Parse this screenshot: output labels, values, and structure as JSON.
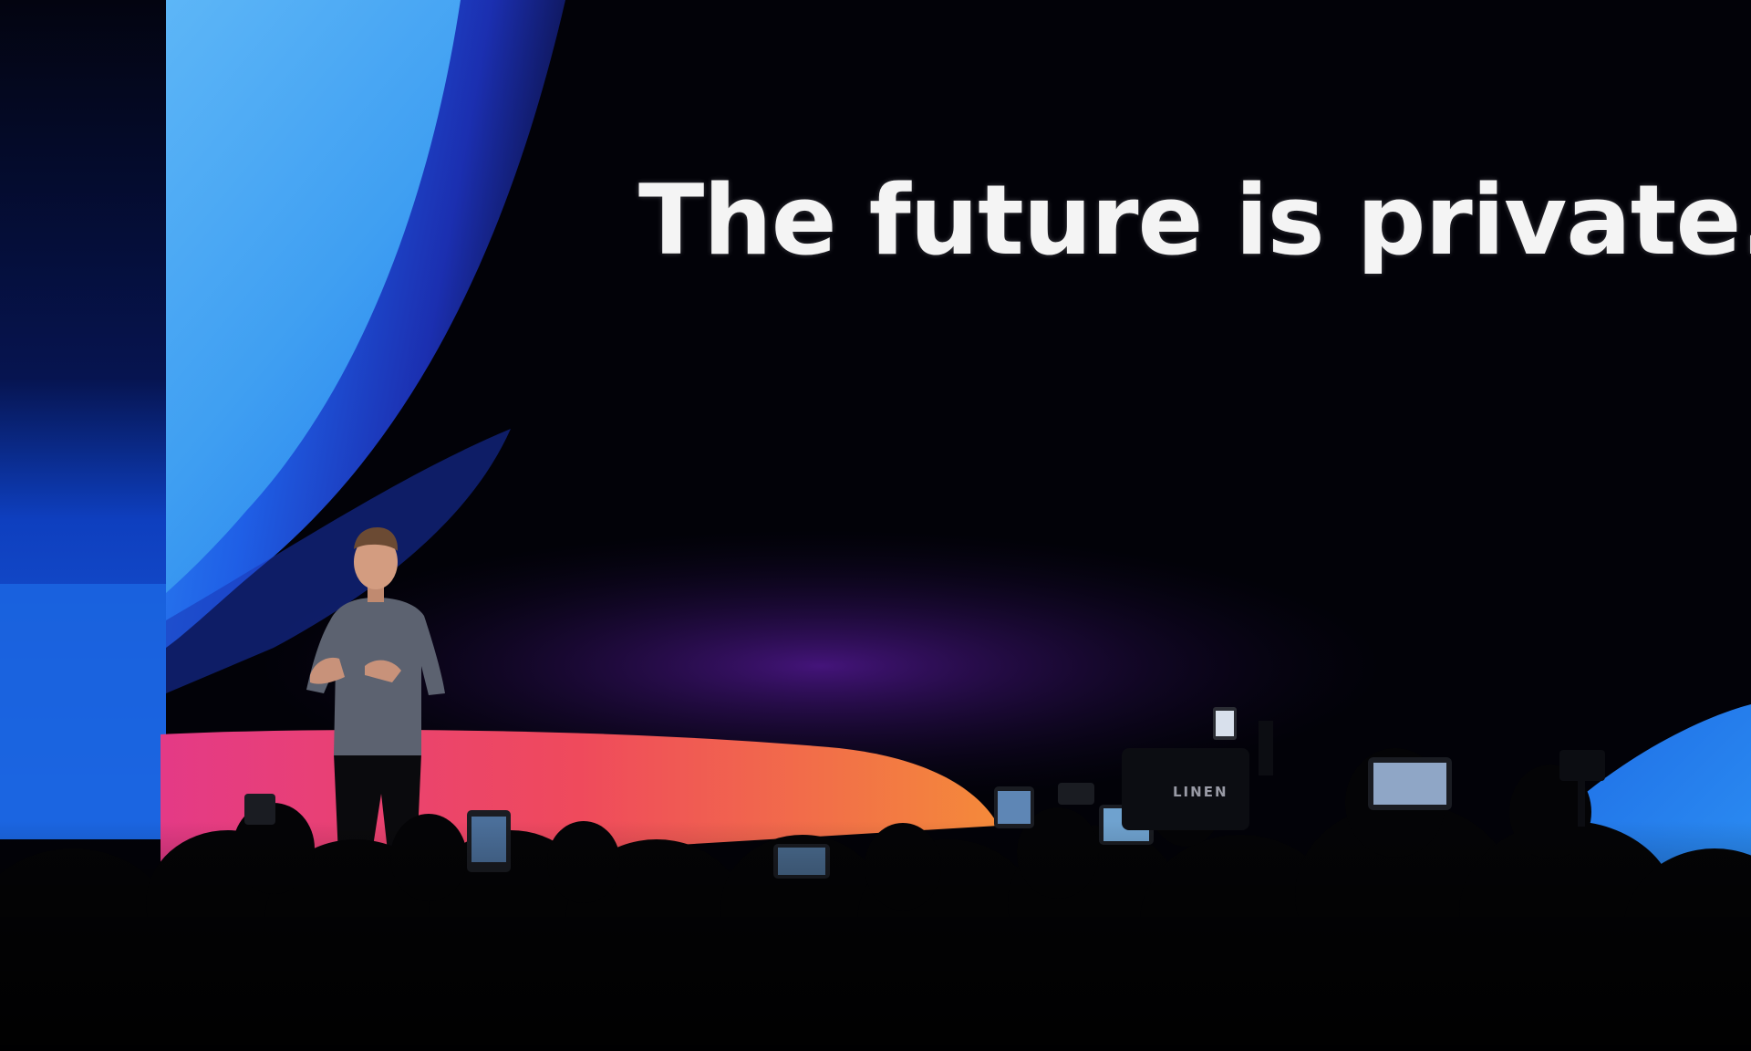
{
  "screen": {
    "headline": "The future is private.",
    "camera_tag": "LINEN"
  },
  "colors": {
    "screen_background": "#020208",
    "blue_wave": "#1f7ff0",
    "light_blue_wave": "#4aa8f5",
    "pink_wave": "#e83a78",
    "orange_wave": "#f06a3a",
    "text": "#f4f4f4"
  }
}
